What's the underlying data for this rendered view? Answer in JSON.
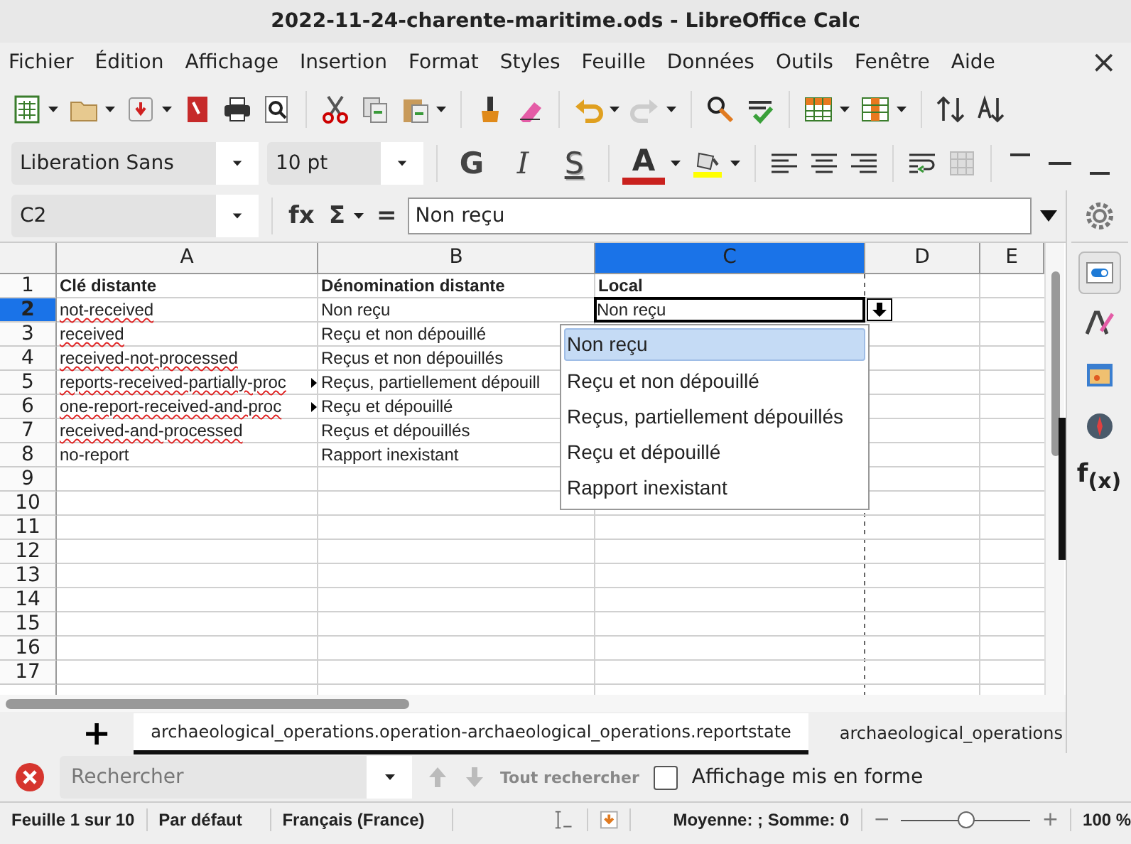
{
  "window": {
    "title": "2022-11-24-charente-maritime.ods - LibreOffice Calc",
    "close": "×"
  },
  "menu": [
    "Fichier",
    "Édition",
    "Affichage",
    "Insertion",
    "Format",
    "Styles",
    "Feuille",
    "Données",
    "Outils",
    "Fenêtre",
    "Aide"
  ],
  "formatting": {
    "font_name": "Liberation Sans",
    "font_size": "10 pt",
    "style_buttons": [
      {
        "kind": "bold",
        "glyph": "G"
      },
      {
        "kind": "italic",
        "glyph": "I"
      },
      {
        "kind": "shadow",
        "glyph": "S"
      }
    ],
    "font_color_glyph": "A"
  },
  "formula_bar": {
    "cell_ref": "C2",
    "function_wizard": "fx",
    "sum": "Σ",
    "equals": "=",
    "content": "Non reçu"
  },
  "columns": [
    {
      "label": "A",
      "selected": false
    },
    {
      "label": "B",
      "selected": false
    },
    {
      "label": "C",
      "selected": true
    },
    {
      "label": "D",
      "selected": false
    },
    {
      "label": "E",
      "selected": false
    }
  ],
  "rows": [
    {
      "number": "1",
      "selected": false,
      "cells": [
        {
          "text": "Clé distante",
          "bold": true,
          "misspelled": false,
          "overflow": false,
          "active": false
        },
        {
          "text": "Dénomination distante",
          "bold": true,
          "misspelled": false,
          "overflow": false,
          "active": false
        },
        {
          "text": "Local",
          "bold": true,
          "misspelled": false,
          "overflow": false,
          "active": false
        }
      ]
    },
    {
      "number": "2",
      "selected": true,
      "cells": [
        {
          "text": "not-received",
          "bold": false,
          "misspelled": true,
          "overflow": false,
          "active": false
        },
        {
          "text": "Non reçu",
          "bold": false,
          "misspelled": false,
          "overflow": false,
          "active": false
        },
        {
          "text": "Non reçu",
          "bold": false,
          "misspelled": false,
          "overflow": false,
          "active": true
        }
      ]
    },
    {
      "number": "3",
      "selected": false,
      "cells": [
        {
          "text": "received",
          "bold": false,
          "misspelled": true,
          "overflow": false,
          "active": false
        },
        {
          "text": "Reçu et non dépouillé",
          "bold": false,
          "misspelled": false,
          "overflow": false,
          "active": false
        }
      ]
    },
    {
      "number": "4",
      "selected": false,
      "cells": [
        {
          "text": "received-not-processed",
          "bold": false,
          "misspelled": true,
          "overflow": false,
          "active": false
        },
        {
          "text": "Reçus et non dépouillés",
          "bold": false,
          "misspelled": false,
          "overflow": false,
          "active": false
        }
      ]
    },
    {
      "number": "5",
      "selected": false,
      "cells": [
        {
          "text": "reports-received-partially-proc",
          "bold": false,
          "misspelled": true,
          "overflow": true,
          "active": false
        },
        {
          "text": "Reçus, partiellement dépouill",
          "bold": false,
          "misspelled": false,
          "overflow": false,
          "active": false
        }
      ]
    },
    {
      "number": "6",
      "selected": false,
      "cells": [
        {
          "text": "one-report-received-and-proc",
          "bold": false,
          "misspelled": true,
          "overflow": true,
          "active": false
        },
        {
          "text": "Reçu et dépouillé",
          "bold": false,
          "misspelled": false,
          "overflow": false,
          "active": false
        }
      ]
    },
    {
      "number": "7",
      "selected": false,
      "cells": [
        {
          "text": "received-and-processed",
          "bold": false,
          "misspelled": true,
          "overflow": false,
          "active": false
        },
        {
          "text": "Reçus et dépouillés",
          "bold": false,
          "misspelled": false,
          "overflow": false,
          "active": false
        }
      ]
    },
    {
      "number": "8",
      "selected": false,
      "cells": [
        {
          "text": "no-report",
          "bold": false,
          "misspelled": false,
          "overflow": false,
          "active": false
        },
        {
          "text": "Rapport inexistant",
          "bold": false,
          "misspelled": false,
          "overflow": false,
          "active": false
        }
      ]
    },
    {
      "number": "9",
      "selected": false,
      "cells": []
    },
    {
      "number": "10",
      "selected": false,
      "cells": []
    },
    {
      "number": "11",
      "selected": false,
      "cells": []
    },
    {
      "number": "12",
      "selected": false,
      "cells": []
    },
    {
      "number": "13",
      "selected": false,
      "cells": []
    },
    {
      "number": "14",
      "selected": false,
      "cells": []
    },
    {
      "number": "15",
      "selected": false,
      "cells": []
    },
    {
      "number": "16",
      "selected": false,
      "cells": []
    },
    {
      "number": "17",
      "selected": false,
      "cells": []
    }
  ],
  "validation_list": {
    "items": [
      {
        "label": "Non reçu",
        "selected": true
      },
      {
        "label": "Reçu et non dépouillé",
        "selected": false
      },
      {
        "label": "Reçus, partiellement dépouillés",
        "selected": false
      },
      {
        "label": "Reçu et dépouillé",
        "selected": false
      },
      {
        "label": "Rapport inexistant",
        "selected": false
      }
    ]
  },
  "sidebar": {
    "items": [
      {
        "kind": "properties",
        "selected": true
      },
      {
        "kind": "styles",
        "selected": false
      },
      {
        "kind": "gallery",
        "selected": false
      },
      {
        "kind": "navigator",
        "selected": false
      },
      {
        "kind": "functions",
        "selected": false,
        "glyph": "f$_{(x)}$"
      }
    ]
  },
  "sheet_tabs": {
    "add": "+",
    "tabs": [
      {
        "label": "archaeological_operations.operation-archaeological_operations.reportstate",
        "selected": true
      },
      {
        "label": "archaeological_operations",
        "selected": false
      }
    ]
  },
  "find_bar": {
    "placeholder": "Rechercher",
    "find_all": "Tout rechercher",
    "formatted_display": {
      "label": "Affichage mis en forme",
      "checked": false
    }
  },
  "status_bar": {
    "sheet": "Feuille 1 sur 10",
    "page_style": "Par défaut",
    "language": "Français (France)",
    "summary": "Moyenne: ; Somme: 0",
    "zoom_minus": "−",
    "zoom_plus": "+",
    "zoom_slider": {
      "level": 0.5
    },
    "zoom": "100 %"
  }
}
